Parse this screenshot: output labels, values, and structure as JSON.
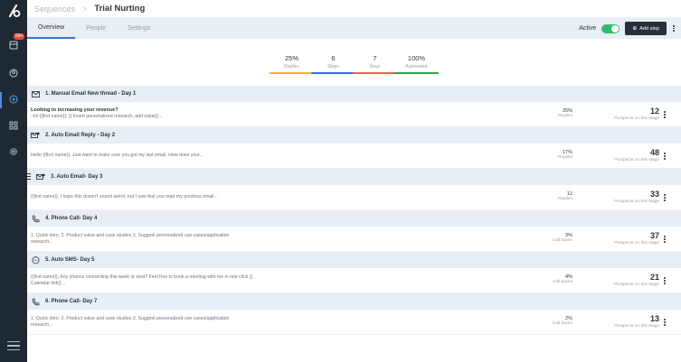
{
  "sidebar": {
    "badge": "99+",
    "icons": [
      "logo-icon",
      "sequences-icon",
      "contacts-icon",
      "campaign-icon",
      "apps-icon",
      "settings-icon",
      "menu-icon"
    ]
  },
  "header": {
    "breadcrumb_parent": "Sequences",
    "breadcrumb_sep": ">",
    "title": "Trial Nurting"
  },
  "tabs": [
    {
      "label": "Overview",
      "active": true
    },
    {
      "label": "People",
      "active": false
    },
    {
      "label": "Settings",
      "active": false
    }
  ],
  "controls": {
    "active_label": "Active",
    "active_on": true,
    "add_step_label": "Add step"
  },
  "stats": [
    {
      "value": "25%",
      "label": "Replies",
      "color": "#f0b429"
    },
    {
      "value": "6",
      "label": "Steps",
      "color": "#3b6fd4"
    },
    {
      "value": "7",
      "label": "Days",
      "color": "#e8684a"
    },
    {
      "value": "100%",
      "label": "Automated",
      "color": "#2ea44f"
    }
  ],
  "stages": [
    {
      "title": "1. Manual Email New thread - Day 1",
      "icon": "mail-icon",
      "subject": "Looking to increasing your revenue?",
      "body": "~Hi {{first name}}, {{ Insert personalized research, add value}}...",
      "metric_value": "25%",
      "metric_label": "Replies",
      "prospects": "12",
      "prospects_label": "Prospects on this stage"
    },
    {
      "title": "2. Auto Email Reply - Day 2",
      "icon": "auto-email-icon",
      "subject": "",
      "body": "Hello {{first name}}, Just want to make sure you got my last email. How does your...",
      "metric_value": "17%",
      "metric_label": "Replies",
      "prospects": "48",
      "prospects_label": "Prospects on this stage"
    },
    {
      "title": "3. Auto Email- Day 3",
      "icon": "auto-email-icon",
      "subject": "",
      "body": "{{first name}}, I hope this doesn't sound weird, but I saw that you read my previous email...",
      "metric_value": "12",
      "metric_label": "Replies",
      "prospects": "33",
      "prospects_label": "Prospects on this stage"
    },
    {
      "title": "4. Phone Call- Day 4",
      "icon": "phone-icon",
      "subject": "",
      "body": "1. Quick intro; 2. Product value and case studies 3. Suggest personalized use cases/application research...",
      "metric_value": "3%",
      "metric_label": "Call backs",
      "prospects": "37",
      "prospects_label": "Prospects on this stage"
    },
    {
      "title": "5. Auto SMS- Day 5",
      "icon": "sms-icon",
      "subject": "",
      "body": "{{first name}}, Any chance connecting this week or next? Feel free to book a meeting with me in one click {{ Calendar link}}...",
      "metric_value": "4%",
      "metric_label": "Call backs",
      "prospects": "21",
      "prospects_label": "Prospects on this stage"
    },
    {
      "title": "6. Phone Call- Day 7",
      "icon": "phone-icon",
      "subject": "",
      "body": "1. Quick intro; 2. Product value and case studies 3. Suggest personalized use cases/application research...",
      "metric_value": "2%",
      "metric_label": "Call backs",
      "prospects": "13",
      "prospects_label": "Prospects on this stage"
    }
  ]
}
